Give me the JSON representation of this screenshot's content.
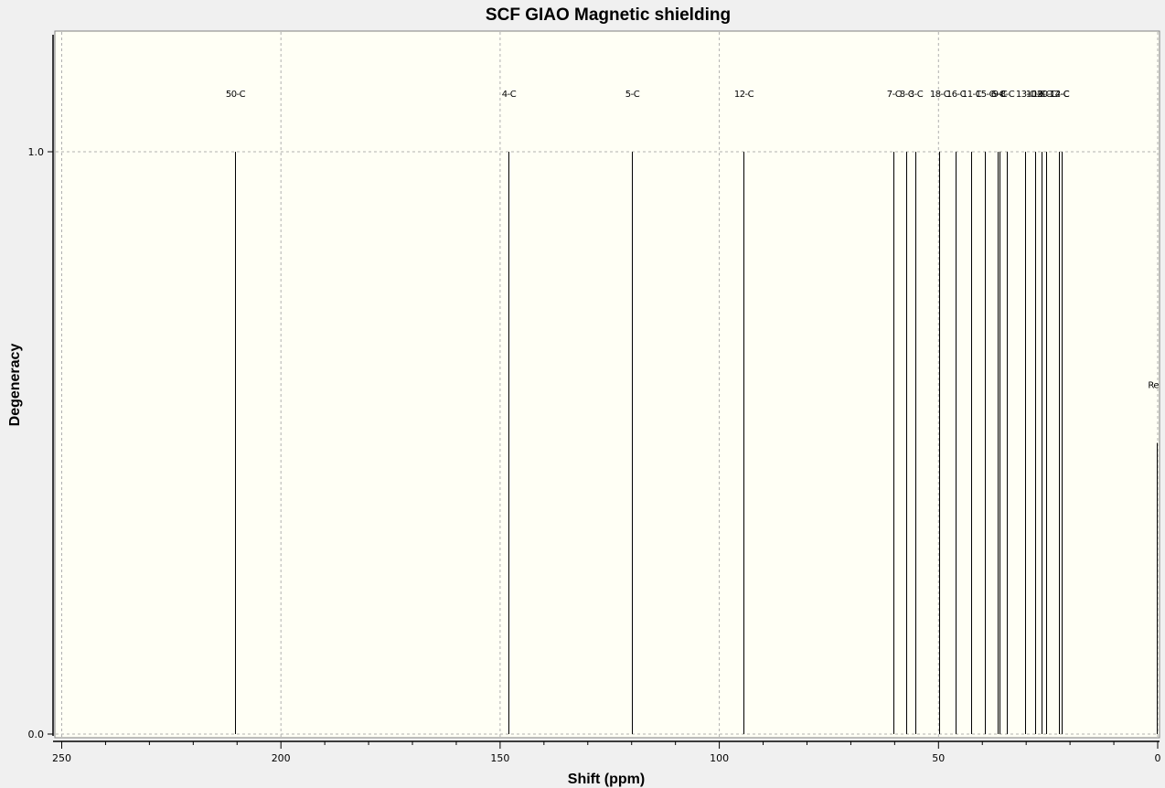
{
  "chart_data": {
    "type": "bar",
    "title": "SCF GIAO Magnetic shielding",
    "xlabel": "Shift (ppm)",
    "ylabel": "Degeneracy",
    "xlim": [
      252,
      0
    ],
    "ylim": [
      0,
      1.2
    ],
    "x_major_ticks": [
      250,
      200,
      150,
      100,
      50,
      0
    ],
    "x_minor_step": 10,
    "y_ticks": [
      {
        "value": 0.0,
        "label": "0.0"
      },
      {
        "value": 1.0,
        "label": "1.0"
      }
    ],
    "grid": true,
    "background": "#fffff5",
    "peaks": [
      {
        "x": 210.5,
        "y": 1.0,
        "label": "50-C"
      },
      {
        "x": 148.0,
        "y": 1.0,
        "label": "4-C"
      },
      {
        "x": 120.0,
        "y": 1.0,
        "label": "5-C"
      },
      {
        "x": 94.5,
        "y": 1.0,
        "label": "12-C"
      },
      {
        "x": 60.2,
        "y": 1.0,
        "label": "7-C"
      },
      {
        "x": 57.3,
        "y": 1.0,
        "label": "8-C"
      },
      {
        "x": 55.2,
        "y": 1.0,
        "label": "3-C"
      },
      {
        "x": 49.8,
        "y": 1.0,
        "label": "18-C"
      },
      {
        "x": 46.2,
        "y": 1.0,
        "label": "16-C"
      },
      {
        "x": 42.6,
        "y": 1.0,
        "label": "11-C"
      },
      {
        "x": 39.5,
        "y": 1.0,
        "label": "15-C"
      },
      {
        "x": 36.5,
        "y": 1.0,
        "label": "6-C"
      },
      {
        "x": 36.1,
        "y": 1.0,
        "label": "9-C"
      },
      {
        "x": 34.5,
        "y": 1.0,
        "label": "8-C"
      },
      {
        "x": 30.3,
        "y": 1.0,
        "label": "13-C"
      },
      {
        "x": 28.0,
        "y": 1.0,
        "label": "10-C"
      },
      {
        "x": 26.5,
        "y": 1.0,
        "label": "19-C"
      },
      {
        "x": 25.5,
        "y": 1.0,
        "label": "20-C"
      },
      {
        "x": 22.5,
        "y": 1.0,
        "label": "14-C"
      },
      {
        "x": 21.8,
        "y": 1.0,
        "label": "2-C"
      },
      {
        "x": 0.2,
        "y": 0.5,
        "label": "Re"
      }
    ]
  }
}
